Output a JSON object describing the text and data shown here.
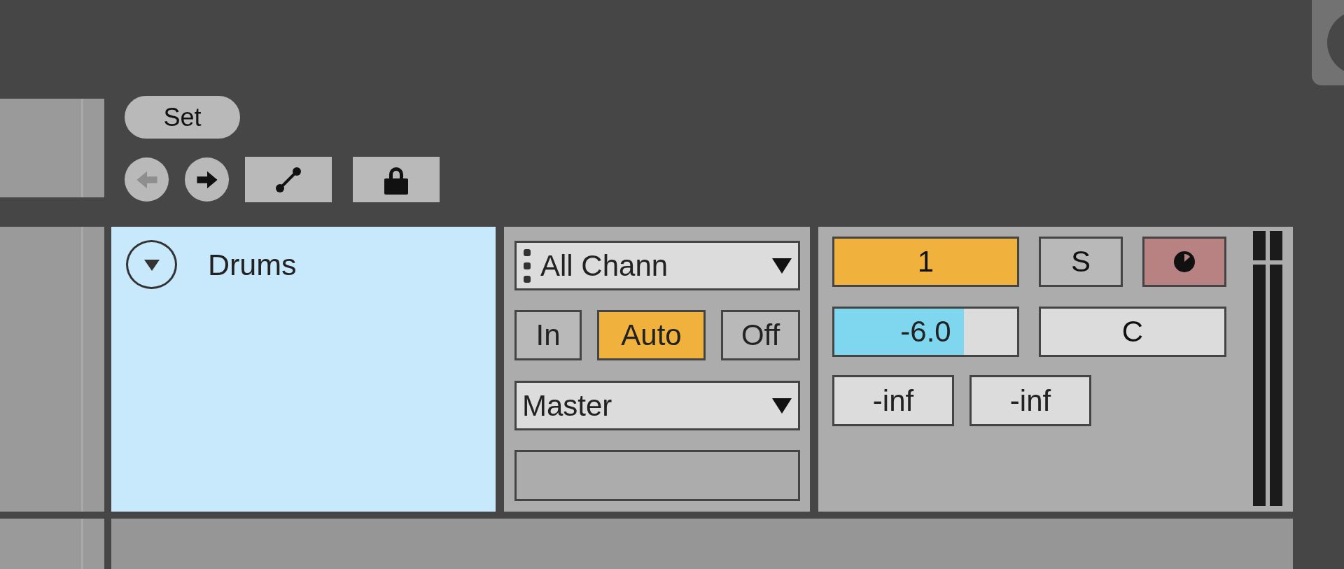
{
  "browser_controls": {
    "set_button": "Set",
    "navigation": [
      {
        "kind": "back",
        "disabled": true
      },
      {
        "kind": "forward",
        "disabled": false
      }
    ]
  },
  "track": {
    "name": "Drums",
    "expanded": true,
    "selected": true
  },
  "io": {
    "input_channel": "All Chann",
    "monitor": [
      {
        "label": "In",
        "selected": false
      },
      {
        "label": "Auto",
        "selected": true
      },
      {
        "label": "Off",
        "selected": false
      }
    ],
    "output": "Master"
  },
  "mixer": {
    "track_activator": {
      "label": "1",
      "on": true
    },
    "solo": {
      "label": "S",
      "on": false
    },
    "arm": {
      "armed": false
    },
    "volume": {
      "value": "-6.0",
      "level": 0.71
    },
    "pan": "C",
    "peaks": [
      "-inf",
      "-inf"
    ]
  }
}
